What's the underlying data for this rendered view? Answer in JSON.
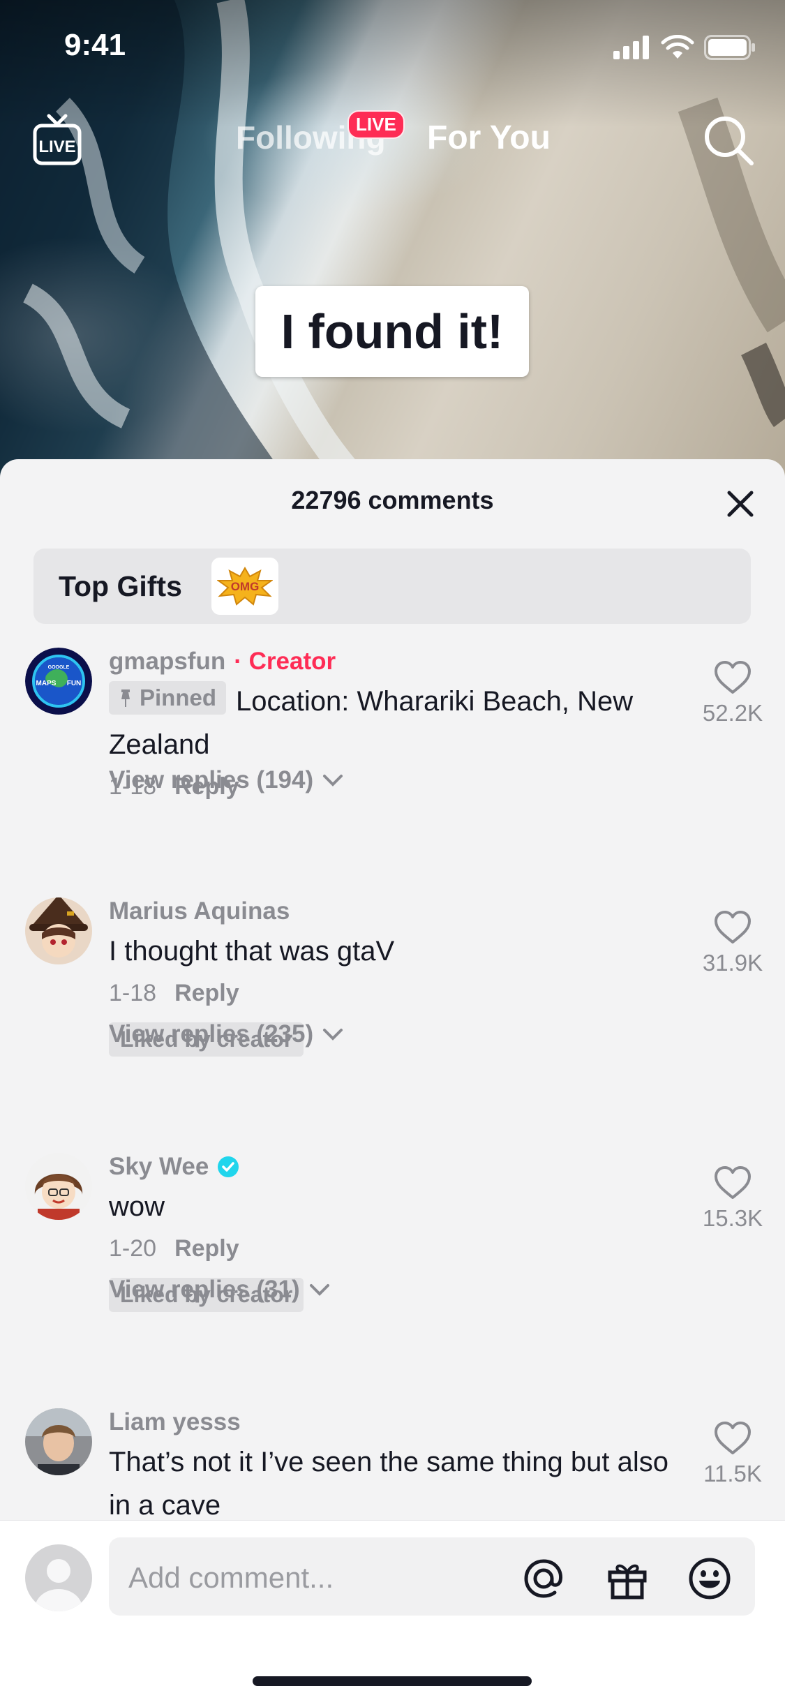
{
  "status_bar": {
    "time": "9:41"
  },
  "top_nav": {
    "live_label": "LIVE",
    "following_label": "Following",
    "live_badge": "LIVE",
    "for_you_label": "For You"
  },
  "video": {
    "caption": "I found it!"
  },
  "comments_sheet": {
    "count_label": "22796 comments",
    "top_gifts_label": "Top Gifts",
    "gift_label": "OMG",
    "comments": [
      {
        "username": "gmapsfun",
        "creator_tag": "· Creator",
        "pinned_label": "Pinned",
        "text": "Location: Wharariki Beach, New Zealand",
        "date": "1-18",
        "reply_label": "Reply",
        "view_replies": "View replies (194)",
        "likes": "52.2K",
        "avatar_text_top": "GOOGLE",
        "avatar_text_left": "MAPS",
        "avatar_text_right": "FUN"
      },
      {
        "username": "Marius Aquinas",
        "text": "I thought that was gtaV",
        "date": "1-18",
        "reply_label": "Reply",
        "liked_by": "Liked by creator",
        "view_replies": "View replies (235)",
        "likes": "31.9K"
      },
      {
        "username": "Sky Wee",
        "text": "wow",
        "date": "1-20",
        "reply_label": "Reply",
        "liked_by": "Liked by creator",
        "view_replies": "View replies (31)",
        "likes": "15.3K"
      },
      {
        "username": "Liam yesss",
        "text": "That’s not it I’ve seen the same thing but also in a cave",
        "likes": "11.5K"
      }
    ]
  },
  "input_bar": {
    "placeholder": "Add comment..."
  },
  "colors": {
    "accent": "#fe2c55",
    "verified": "#20d5ec",
    "text": "#161823",
    "muted": "#8a8b91"
  }
}
